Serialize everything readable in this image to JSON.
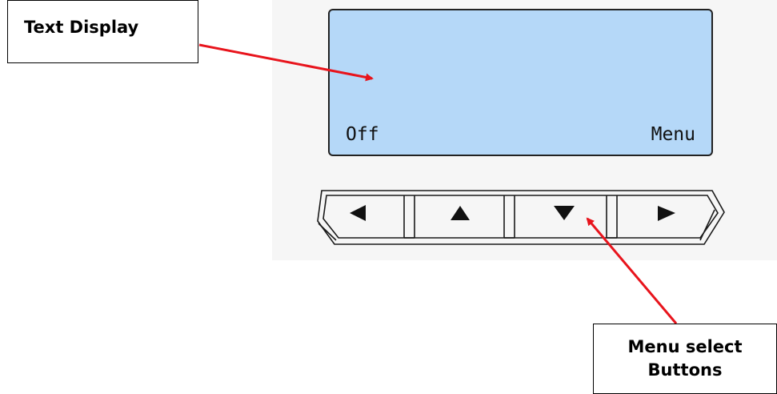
{
  "callouts": {
    "text_display": "Text Display",
    "menu_select_line1": "Menu select",
    "menu_select_line2": "Buttons"
  },
  "display": {
    "left_softkey": "Off",
    "right_softkey": "Menu",
    "background_color": "#b5d8f8"
  },
  "buttons": [
    {
      "icon": "triangle-left-icon"
    },
    {
      "icon": "triangle-up-icon"
    },
    {
      "icon": "triangle-down-icon"
    },
    {
      "icon": "triangle-right-icon"
    }
  ],
  "arrow_color": "#e8141c"
}
